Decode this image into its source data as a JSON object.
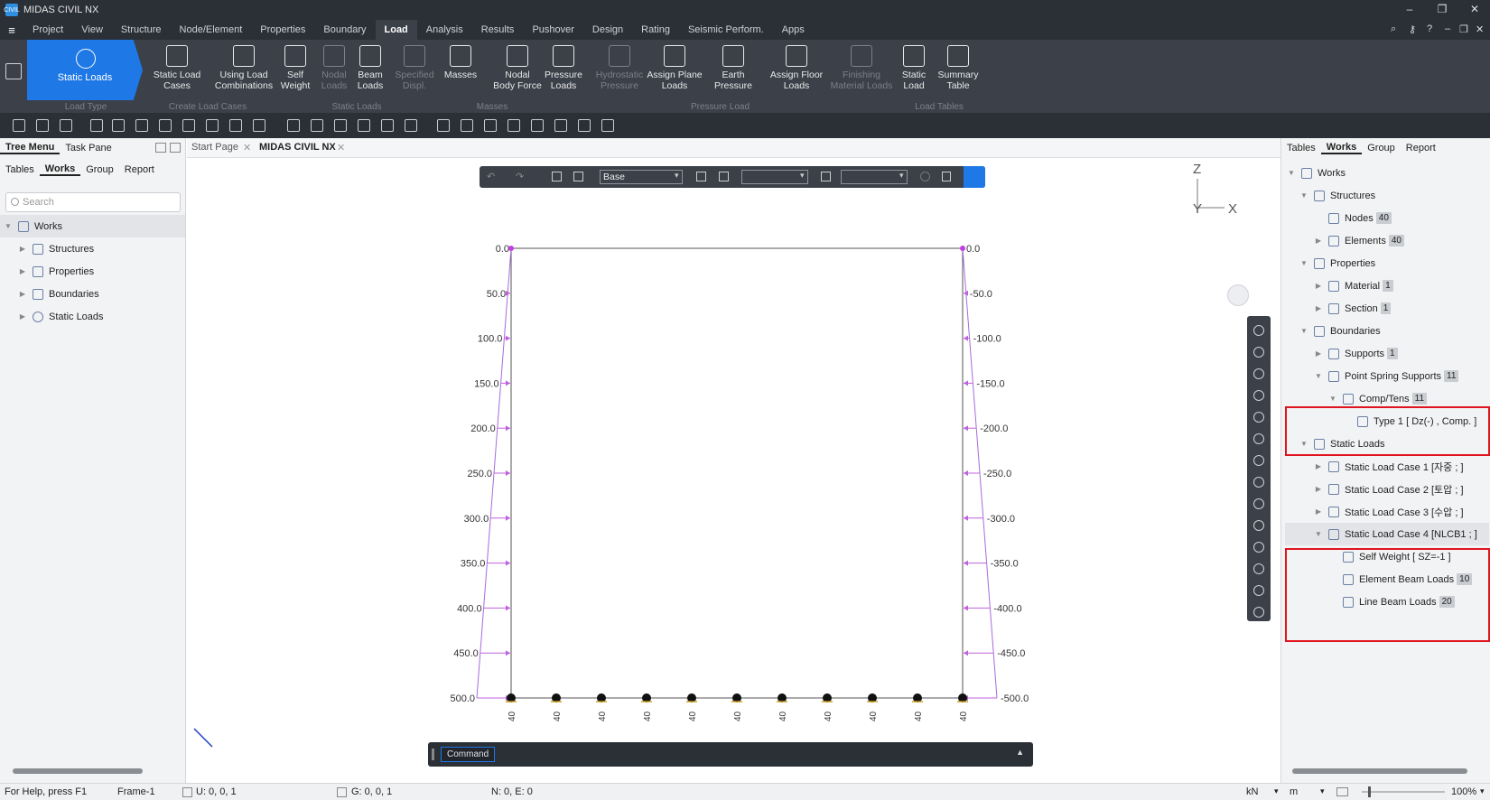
{
  "window": {
    "title": "MIDAS CIVIL NX",
    "logo_text": "CIVIL"
  },
  "menu": [
    "Project",
    "View",
    "Structure",
    "Node/Element",
    "Properties",
    "Boundary",
    "Load",
    "Analysis",
    "Results",
    "Pushover",
    "Design",
    "Rating",
    "Seismic Perform.",
    "Apps"
  ],
  "menu_active": "Load",
  "ribbon": {
    "active_type": "Static Loads",
    "buttons": [
      {
        "label": "Static Load\nCases",
        "icon": "lc-icon",
        "disabled": false
      },
      {
        "label": "Using Load\nCombinations",
        "icon": "lc-combo-icon",
        "disabled": false
      },
      {
        "label": "Self\nWeight",
        "icon": "self-weight-icon",
        "disabled": false
      },
      {
        "label": "Nodal\nLoads",
        "icon": "nodal-load-icon",
        "disabled": true
      },
      {
        "label": "Beam\nLoads",
        "icon": "beam-load-icon",
        "disabled": false
      },
      {
        "label": "Specified\nDispl.",
        "icon": "displ-icon",
        "disabled": true
      },
      {
        "label": "Masses",
        "icon": "mass-icon",
        "disabled": false
      },
      {
        "label": "Nodal\nBody Force",
        "icon": "body-force-icon",
        "disabled": false
      },
      {
        "label": "Pressure\nLoads",
        "icon": "pressure-icon",
        "disabled": false
      },
      {
        "label": "Hydrostatic\nPressure",
        "icon": "hydro-icon",
        "disabled": true
      },
      {
        "label": "Assign Plane\nLoads",
        "icon": "plane-load-icon",
        "disabled": false
      },
      {
        "label": "Earth\nPressure",
        "icon": "earth-pressure-icon",
        "disabled": false
      },
      {
        "label": "Assign Floor\nLoads",
        "icon": "floor-load-icon",
        "disabled": false
      },
      {
        "label": "Finishing\nMaterial Loads",
        "icon": "finishing-icon",
        "disabled": true
      },
      {
        "label": "Static\nLoad",
        "icon": "static-load-table-icon",
        "disabled": false
      },
      {
        "label": "Summary\nTable",
        "icon": "summary-table-icon",
        "disabled": false
      }
    ],
    "groups": [
      "Load Type",
      "Create Load Cases",
      "Static Loads",
      "Masses",
      "Pressure Load",
      "Load Tables"
    ]
  },
  "left_panel": {
    "top_tabs": [
      "Tree Menu",
      "Task Pane"
    ],
    "sub_tabs": [
      "Tables",
      "Works",
      "Group",
      "Report"
    ],
    "search_placeholder": "Search",
    "tree": [
      "Works",
      "Structures",
      "Properties",
      "Boundaries",
      "Static Loads"
    ]
  },
  "doc_tabs": [
    "Start Page",
    "MIDAS CIVIL NX"
  ],
  "view_toolbar": {
    "base_select": "Base"
  },
  "axes": {
    "z": "Z",
    "y": "Y",
    "x": "X"
  },
  "diagram": {
    "left_labels": [
      "0.0",
      "50.0",
      "100.0",
      "150.0",
      "200.0",
      "250.0",
      "300.0",
      "350.0",
      "400.0",
      "450.0",
      "500.0"
    ],
    "right_labels": [
      "0.0",
      "-50.0",
      "-100.0",
      "-150.0",
      "-200.0",
      "-250.0",
      "-300.0",
      "-350.0",
      "-400.0",
      "-450.0",
      "-500.0"
    ],
    "bottom_labels": [
      "40",
      "40",
      "40",
      "40",
      "40",
      "40",
      "40",
      "40",
      "40",
      "40",
      "40"
    ]
  },
  "command": {
    "label": "Command"
  },
  "right_panel": {
    "tabs": [
      "Tables",
      "Works",
      "Group",
      "Report"
    ],
    "tree": [
      {
        "label": "Works",
        "level": 0,
        "badge": ""
      },
      {
        "label": "Structures",
        "level": 1,
        "badge": ""
      },
      {
        "label": "Nodes",
        "level": 2,
        "badge": "40"
      },
      {
        "label": "Elements",
        "level": 2,
        "badge": "40"
      },
      {
        "label": "Properties",
        "level": 1,
        "badge": ""
      },
      {
        "label": "Material",
        "level": 2,
        "badge": "1"
      },
      {
        "label": "Section",
        "level": 2,
        "badge": "1"
      },
      {
        "label": "Boundaries",
        "level": 1,
        "badge": ""
      },
      {
        "label": "Supports",
        "level": 2,
        "badge": "1"
      },
      {
        "label": "Point Spring Supports",
        "level": 2,
        "badge": "11"
      },
      {
        "label": "Comp/Tens",
        "level": 3,
        "badge": "11"
      },
      {
        "label": "Type 1 [ Dz(-) , Comp. ]",
        "level": 4,
        "badge": ""
      },
      {
        "label": "Static Loads",
        "level": 1,
        "badge": ""
      },
      {
        "label": "Static Load Case 1 [자중 ; ]",
        "level": 2,
        "badge": ""
      },
      {
        "label": "Static Load Case 2 [토압 ; ]",
        "level": 2,
        "badge": ""
      },
      {
        "label": "Static Load Case 3 [수압 ; ]",
        "level": 2,
        "badge": ""
      },
      {
        "label": "Static Load Case 4 [NLCB1 ; ]",
        "level": 2,
        "badge": ""
      },
      {
        "label": "Self Weight [ SZ=-1 ]",
        "level": 3,
        "badge": ""
      },
      {
        "label": "Element Beam Loads",
        "level": 3,
        "badge": "10"
      },
      {
        "label": "Line Beam Loads",
        "level": 3,
        "badge": "20"
      }
    ]
  },
  "status": {
    "help": "For Help, press F1",
    "frame": "Frame-1",
    "u": "U: 0, 0, 1",
    "g": "G: 0, 0, 1",
    "ne": "N: 0, E: 0",
    "force_unit": "kN",
    "length_unit": "m",
    "zoom": "100%"
  }
}
